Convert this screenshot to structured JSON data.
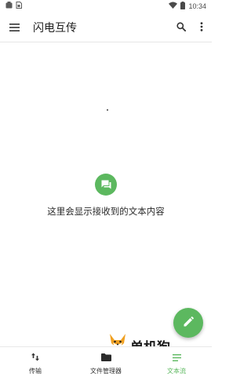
{
  "status_bar": {
    "time": "10:34",
    "icons": [
      "notification-app-icon",
      "sim-card-icon",
      "wifi-icon",
      "battery-icon"
    ]
  },
  "app_bar": {
    "title": "闪电互传",
    "icons": [
      "menu-icon",
      "search-icon",
      "more-vert-icon"
    ]
  },
  "empty_state": {
    "icon": "chat-icon",
    "message": "这里会显示接收到的文本内容"
  },
  "fab": {
    "icon": "edit-pencil-icon"
  },
  "bottom_nav": {
    "active_index": 2,
    "items": [
      {
        "label": "传输",
        "icon": "transfer-arrows-icon"
      },
      {
        "label": "文件管理器",
        "icon": "folder-icon"
      },
      {
        "label": "文本流",
        "icon": "text-lines-icon"
      }
    ]
  },
  "watermark": {
    "text": "单机狗"
  },
  "colors": {
    "accent": "#5cb85f",
    "background": "#ffffff",
    "text": "#212121"
  }
}
